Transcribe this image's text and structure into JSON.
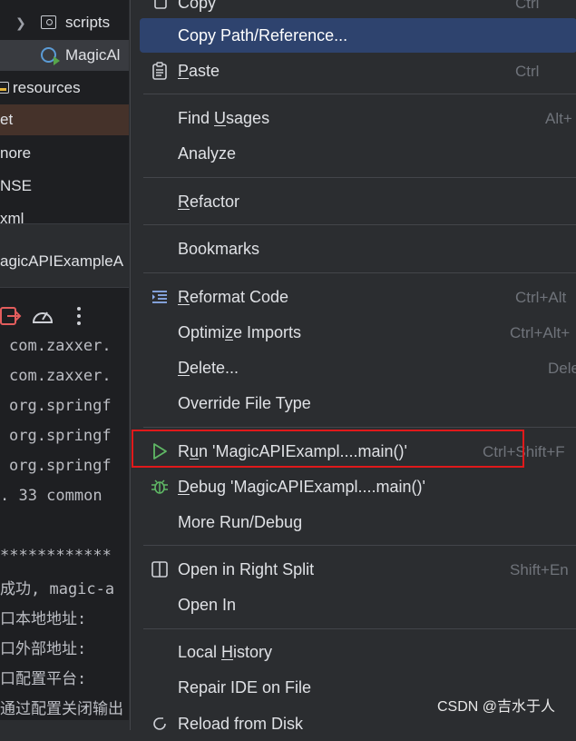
{
  "tree": {
    "scripts": "scripts",
    "magic_file": "MagicAl",
    "resources": "resources",
    "target": "et",
    "gitignore": "nore",
    "license": "NSE",
    "pom": "xml"
  },
  "run_panel": {
    "tab_label": "agicAPIExampleA"
  },
  "console": {
    "lines": [
      "com.zaxxer.",
      "com.zaxxer.",
      "org.springf",
      "org.springf",
      "org.springf",
      ". 33 common",
      "",
      "************",
      "成功, magic-a",
      "口本地地址:",
      "口外部地址:",
      "口配置平台:",
      "通过配置关闭输出"
    ]
  },
  "menu": {
    "copy": {
      "label": "Copy",
      "shortcut": "Ctrl"
    },
    "copy_path": {
      "label": "Copy Path/Reference..."
    },
    "paste": {
      "label": "Paste",
      "shortcut": "Ctrl"
    },
    "find_usages": {
      "label": "Find Usages",
      "shortcut": "Alt+"
    },
    "analyze": {
      "label": "Analyze"
    },
    "refactor": {
      "label": "Refactor"
    },
    "bookmarks": {
      "label": "Bookmarks"
    },
    "reformat": {
      "label": "Reformat Code",
      "shortcut": "Ctrl+Alt"
    },
    "optimize": {
      "label": "Optimize Imports",
      "shortcut": "Ctrl+Alt+"
    },
    "delete": {
      "label": "Delete...",
      "shortcut": "Dele"
    },
    "override": {
      "label": "Override File Type"
    },
    "run": {
      "label": "Run 'MagicAPIExampl....main()'",
      "shortcut": "Ctrl+Shift+F"
    },
    "debug": {
      "label": "Debug 'MagicAPIExampl....main()'"
    },
    "more_run": {
      "label": "More Run/Debug"
    },
    "open_right": {
      "label": "Open in Right Split",
      "shortcut": "Shift+En"
    },
    "open_in": {
      "label": "Open In"
    },
    "local_history": {
      "label": "Local History"
    },
    "repair": {
      "label": "Repair IDE on File"
    },
    "reload": {
      "label": "Reload from Disk"
    }
  },
  "watermark": "CSDN @吉水于人",
  "colors": {
    "menu_bg": "#2b2d30",
    "selected": "#2e436e",
    "highlight_box": "#e0191b",
    "run_icon": "#5fb865"
  }
}
